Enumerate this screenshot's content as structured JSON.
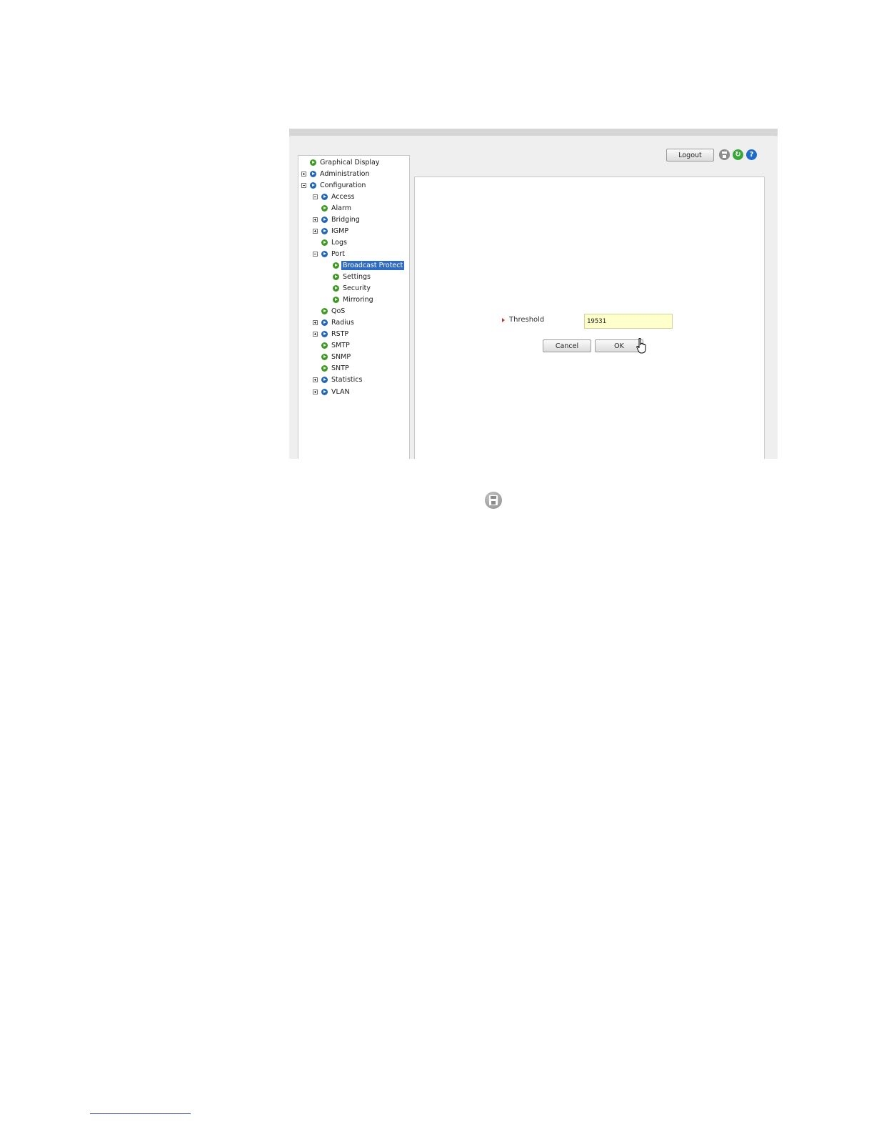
{
  "toolbar": {
    "logout_label": "Logout",
    "icons": [
      "save-icon",
      "refresh-icon",
      "help-icon"
    ],
    "help_glyph": "?",
    "refresh_glyph": "↻"
  },
  "nav_tree": {
    "items": [
      {
        "label": "Graphical Display",
        "level": 0,
        "expander": "none",
        "bullet": "green"
      },
      {
        "label": "Administration",
        "level": 0,
        "expander": "plus",
        "bullet": "blue"
      },
      {
        "label": "Configuration",
        "level": 0,
        "expander": "minus",
        "bullet": "blue"
      },
      {
        "label": "Access",
        "level": 1,
        "expander": "minus",
        "bullet": "blue"
      },
      {
        "label": "Alarm",
        "level": 1,
        "expander": "none",
        "bullet": "green"
      },
      {
        "label": "Bridging",
        "level": 1,
        "expander": "plus",
        "bullet": "blue"
      },
      {
        "label": "IGMP",
        "level": 1,
        "expander": "plus",
        "bullet": "blue"
      },
      {
        "label": "Logs",
        "level": 1,
        "expander": "none",
        "bullet": "green"
      },
      {
        "label": "Port",
        "level": 1,
        "expander": "minus",
        "bullet": "blue"
      },
      {
        "label": "Broadcast Protect",
        "level": 2,
        "expander": "none",
        "bullet": "green",
        "selected": true
      },
      {
        "label": "Settings",
        "level": 2,
        "expander": "none",
        "bullet": "green"
      },
      {
        "label": "Security",
        "level": 2,
        "expander": "none",
        "bullet": "green"
      },
      {
        "label": "Mirroring",
        "level": 2,
        "expander": "none",
        "bullet": "green"
      },
      {
        "label": "QoS",
        "level": 1,
        "expander": "none",
        "bullet": "green"
      },
      {
        "label": "Radius",
        "level": 1,
        "expander": "plus",
        "bullet": "blue"
      },
      {
        "label": "RSTP",
        "level": 1,
        "expander": "plus",
        "bullet": "blue"
      },
      {
        "label": "SMTP",
        "level": 1,
        "expander": "none",
        "bullet": "green"
      },
      {
        "label": "SNMP",
        "level": 1,
        "expander": "none",
        "bullet": "green"
      },
      {
        "label": "SNTP",
        "level": 1,
        "expander": "none",
        "bullet": "green"
      },
      {
        "label": "Statistics",
        "level": 1,
        "expander": "plus",
        "bullet": "blue"
      },
      {
        "label": "VLAN",
        "level": 1,
        "expander": "plus",
        "bullet": "blue"
      }
    ]
  },
  "form": {
    "threshold_label": "Threshold",
    "threshold_value": "19531",
    "cancel_label": "Cancel",
    "ok_label": "OK"
  },
  "colors": {
    "selection": "#2f6cc0",
    "node_green": "#3c9a20",
    "node_blue": "#1f68b8",
    "input_bg": "#ffffcc",
    "help_blue": "#1f6cc8",
    "refresh_green": "#3aa53a"
  },
  "caption_icon": "save-icon"
}
